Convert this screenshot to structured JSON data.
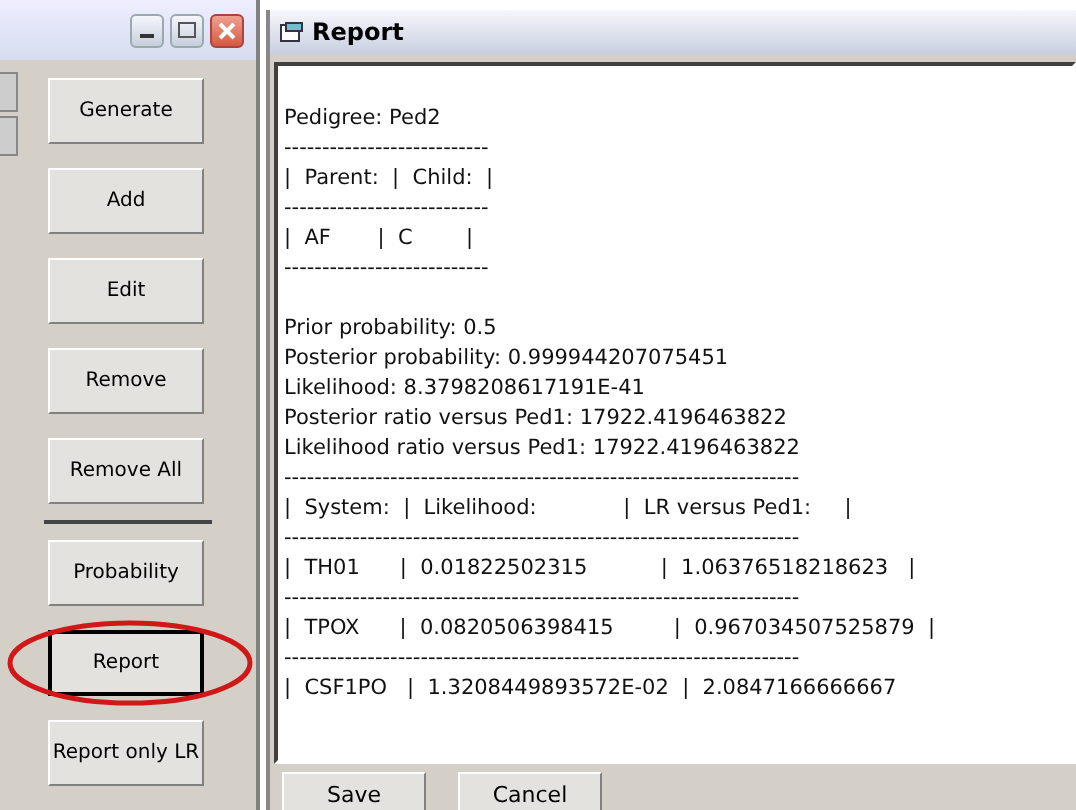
{
  "sidebar": {
    "buttons": [
      {
        "label": "Generate",
        "focused": false,
        "circled": false
      },
      {
        "label": "Add",
        "focused": false,
        "circled": false
      },
      {
        "label": "Edit",
        "focused": false,
        "circled": false
      },
      {
        "label": "Remove",
        "focused": false,
        "circled": false
      },
      {
        "label": "Remove All",
        "focused": false,
        "circled": false
      },
      {
        "label": "Probability",
        "focused": false,
        "circled": false
      },
      {
        "label": "Report",
        "focused": true,
        "circled": true
      },
      {
        "label": "Report only LR",
        "focused": false,
        "circled": false
      }
    ]
  },
  "report_window": {
    "title": "Report",
    "blocks": [
      [
        "Pedigree: Ped2",
        "---------------------------",
        "|  Parent:  |  Child:  |",
        "---------------------------",
        "|  AF       |  C        |",
        "---------------------------"
      ],
      [
        "Prior probability: 0.5",
        "Posterior probability: 0.999944207075451",
        "Likelihood: 8.3798208617191E-41",
        "Posterior ratio versus Ped1: 17922.4196463822",
        "Likelihood ratio versus Ped1: 17922.4196463822",
        "--------------------------------------------------------------------",
        "|  System:  |  Likelihood:             |  LR versus Ped1:     |",
        "--------------------------------------------------------------------",
        "|  TH01      |  0.01822502315           |  1.06376518218623   |",
        "--------------------------------------------------------------------",
        "|  TPOX      |  0.0820506398415         |  0.967034507525879  |",
        "--------------------------------------------------------------------",
        "|  CSF1PO   |  1.3208449893572E-02  |  2.0847166666667"
      ]
    ],
    "buttons": [
      "Save",
      "Cancel"
    ]
  }
}
